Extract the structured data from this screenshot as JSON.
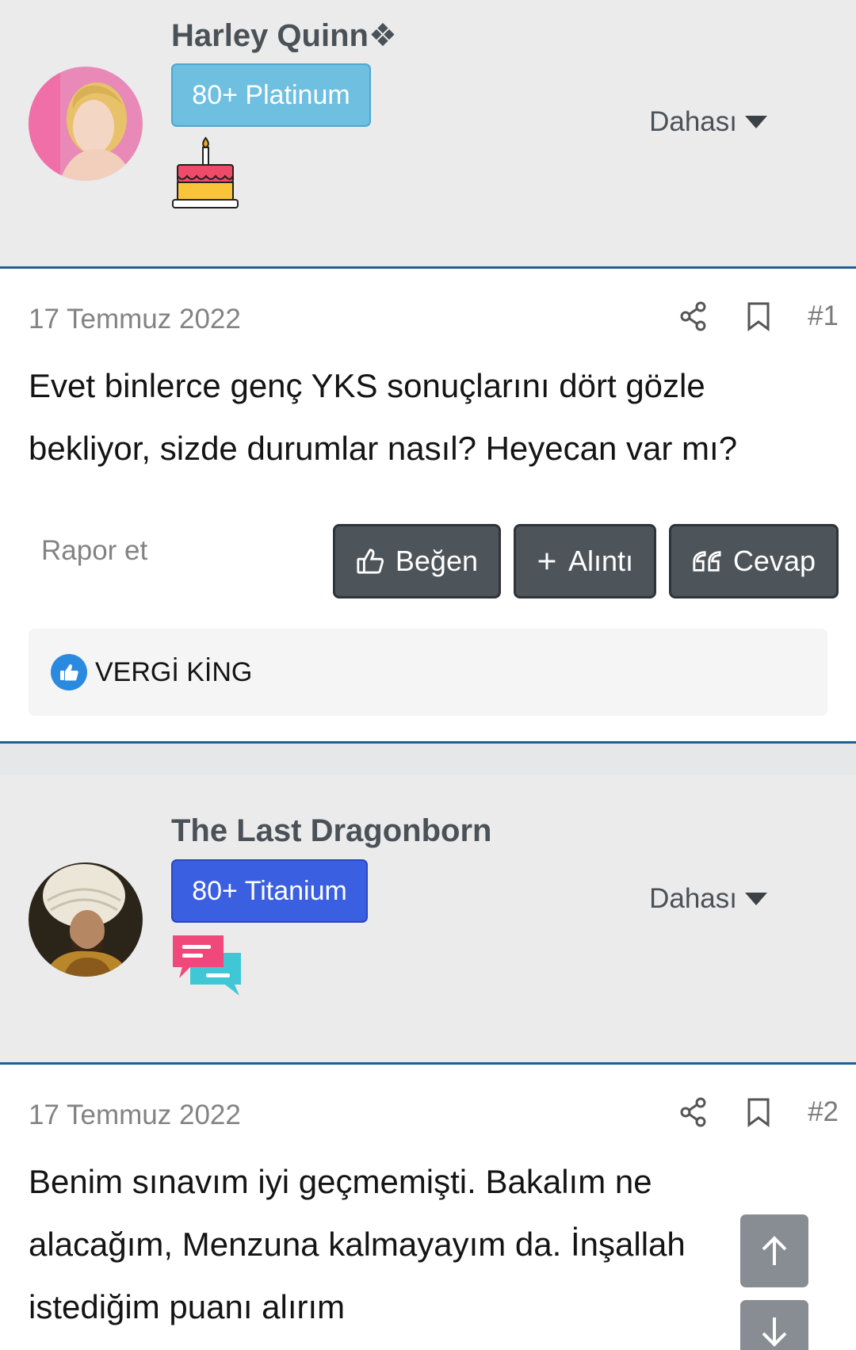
{
  "posts": [
    {
      "user": {
        "name": "Harley Quinn❖",
        "rank": "80+ Platinum",
        "trophy_icon": "birthday-cake-icon",
        "rank_color": "#6ebfe0"
      },
      "more_label": "Dahası",
      "date": "17 Temmuz 2022",
      "number": "#1",
      "body": "Evet binlerce genç YKS sonuçlarını dört gözle bekliyor, sizde durumlar nasıl? Heyecan var mı?",
      "report_label": "Rapor et",
      "actions": {
        "like": "Beğen",
        "quote": "Alıntı",
        "reply": "Cevap"
      },
      "reactions": [
        {
          "user": "VERGİ KİNG",
          "icon": "like-reaction-icon"
        }
      ]
    },
    {
      "user": {
        "name": "The Last Dragonborn",
        "rank": "80+ Titanium",
        "trophy_icon": "chat-bubbles-icon",
        "rank_color": "#3a5fe0"
      },
      "more_label": "Dahası",
      "date": "17 Temmuz 2022",
      "number": "#2",
      "body": "Benim sınavım iyi geçmemişti. Bakalım ne alacağım, Menzuna kalmayayım da. İnşallah istediğim puanı alırım"
    }
  ],
  "colors": {
    "accent": "#1f5f93",
    "button": "#4d545a",
    "like": "#2a8ae0"
  }
}
